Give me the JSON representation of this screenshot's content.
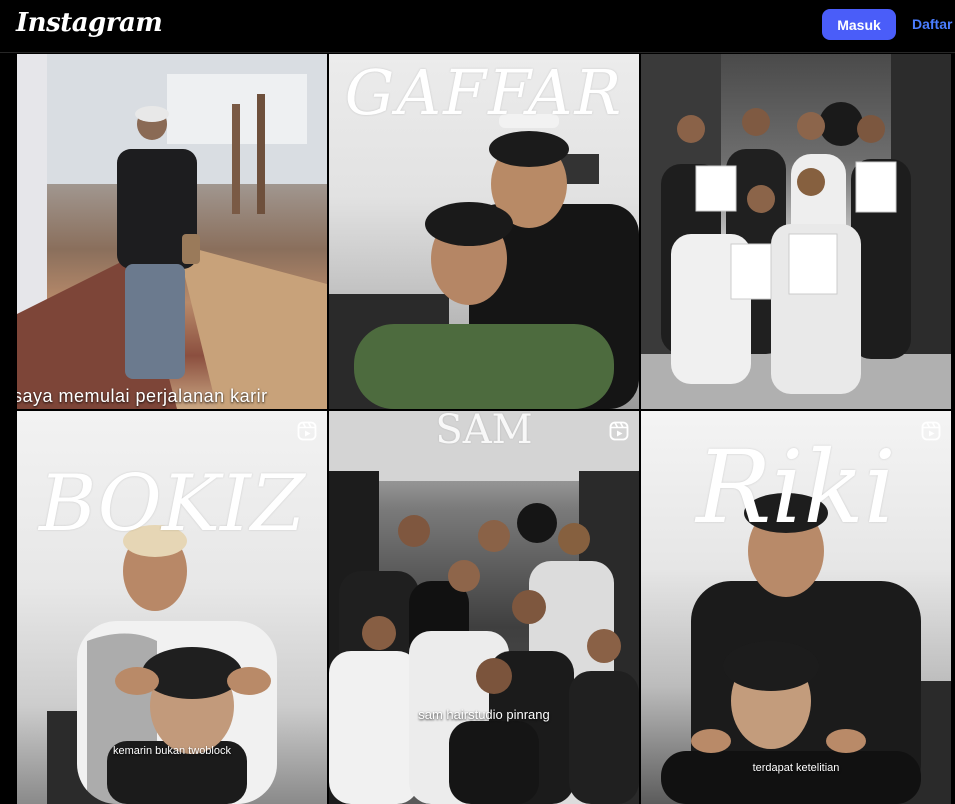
{
  "header": {
    "logo_text": "Instagram",
    "login_label": "Masuk",
    "signup_label": "Daftar",
    "accent_color": "#4a5df9"
  },
  "grid": {
    "tiles": [
      {
        "caption": "saya memulai perjalanan karir",
        "reel_icon": false
      },
      {
        "overlay_title": "GAFFAR",
        "reel_icon": false
      },
      {
        "reel_icon": false
      },
      {
        "overlay_title": "BOKIZ",
        "caption": "kemarin bukan twoblock",
        "reel_icon": true,
        "icon": "reel-icon"
      },
      {
        "overlay_title": "SAM",
        "caption": "sam hairstudio pinrang",
        "reel_icon": true,
        "icon": "reel-icon"
      },
      {
        "overlay_title": "Riki",
        "caption": "terdapat ketelitian",
        "reel_icon": true,
        "icon": "reel-icon"
      }
    ]
  }
}
